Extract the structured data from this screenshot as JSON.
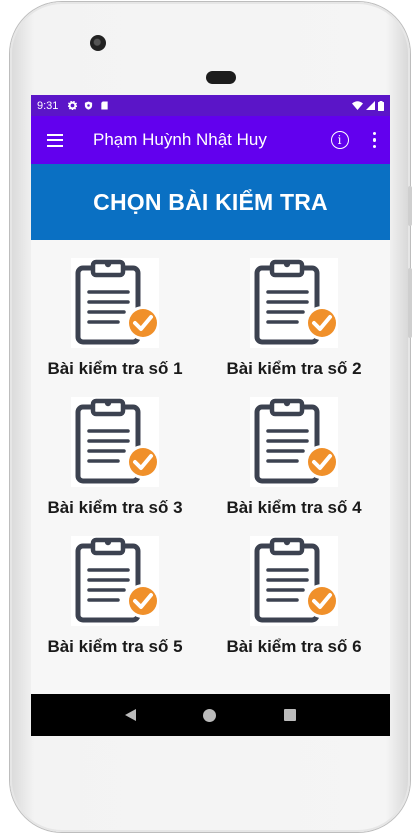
{
  "status_bar": {
    "time": "9:31",
    "icons": [
      "settings-icon",
      "shield-icon",
      "sim-card-icon"
    ],
    "right_icons": [
      "wifi-icon",
      "signal-icon",
      "battery-icon"
    ]
  },
  "app_bar": {
    "title": "Phạm Huỳnh Nhật Huy",
    "menu_icon": "hamburger-menu-icon",
    "info_icon_glyph": "i",
    "overflow_icon": "more-vert-icon"
  },
  "banner": {
    "title": "CHỌN BÀI KIỂM TRA"
  },
  "tests": [
    {
      "label": "Bài kiểm tra số 1",
      "icon": "clipboard-check-icon"
    },
    {
      "label": "Bài kiểm tra số 2",
      "icon": "clipboard-check-icon"
    },
    {
      "label": "Bài kiểm tra số 3",
      "icon": "clipboard-check-icon"
    },
    {
      "label": "Bài kiểm tra số 4",
      "icon": "clipboard-check-icon"
    },
    {
      "label": "Bài kiểm tra số 5",
      "icon": "clipboard-check-icon"
    },
    {
      "label": "Bài kiểm tra số 6",
      "icon": "clipboard-check-icon"
    }
  ],
  "nav_bar": {
    "icons": [
      "back-icon",
      "home-icon",
      "recents-icon"
    ]
  },
  "colors": {
    "status_bar": "#5b15c8",
    "app_bar": "#6200ee",
    "banner": "#0a70c3",
    "clipboard": "#3c4250",
    "check_badge": "#f0902a"
  }
}
